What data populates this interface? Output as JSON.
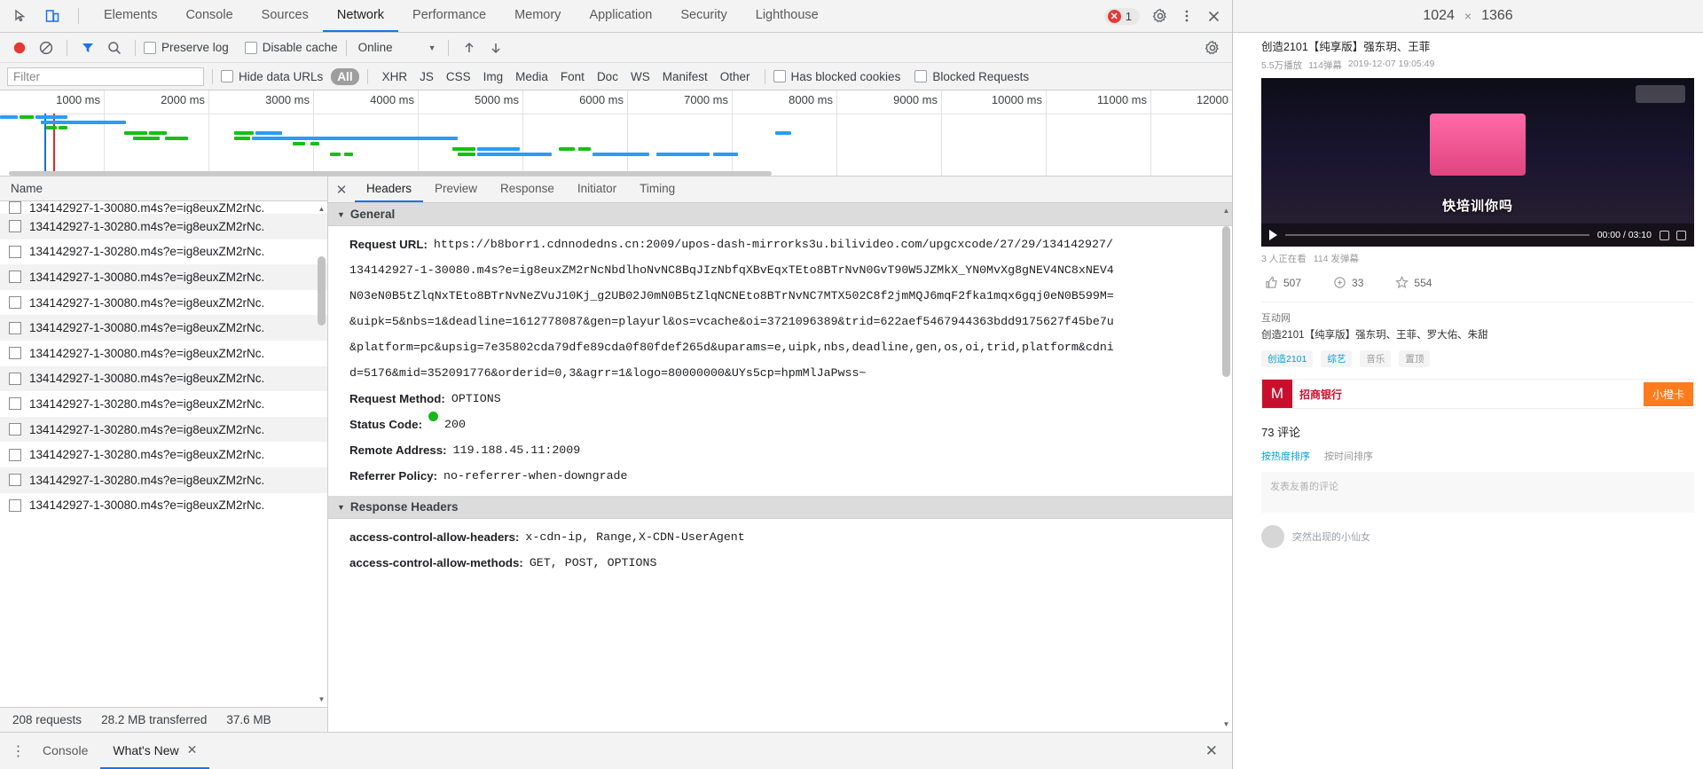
{
  "devtools": {
    "tabs": [
      {
        "label": "Elements",
        "active": false
      },
      {
        "label": "Console",
        "active": false
      },
      {
        "label": "Sources",
        "active": false
      },
      {
        "label": "Network",
        "active": true
      },
      {
        "label": "Performance",
        "active": false
      },
      {
        "label": "Memory",
        "active": false
      },
      {
        "label": "Application",
        "active": false
      },
      {
        "label": "Security",
        "active": false
      },
      {
        "label": "Lighthouse",
        "active": false
      }
    ],
    "error_count": "1",
    "icons": {
      "inspect": "inspect-element-icon",
      "device": "device-toolbar-icon",
      "settings": "gear-icon",
      "more": "kebab-menu-icon",
      "close": "close-icon"
    },
    "network_toolbar": {
      "record_label": "record-button",
      "clear_label": "clear-button",
      "filter_label": "filter-button",
      "search_label": "search-button",
      "preserve_log": "Preserve log",
      "disable_cache": "Disable cache",
      "throttle_value": "Online",
      "import_label": "import-har-button",
      "export_label": "export-har-button",
      "settings_label": "network-settings-button"
    },
    "filter_bar": {
      "placeholder": "Filter",
      "hide_data_urls": "Hide data URLs",
      "types": [
        "All",
        "XHR",
        "JS",
        "CSS",
        "Img",
        "Media",
        "Font",
        "Doc",
        "WS",
        "Manifest",
        "Other"
      ],
      "active_type": "All",
      "has_blocked_cookies": "Has blocked cookies",
      "blocked_requests": "Blocked Requests"
    },
    "overview": {
      "ticks": [
        "1000 ms",
        "2000 ms",
        "3000 ms",
        "4000 ms",
        "5000 ms",
        "6000 ms",
        "7000 ms",
        "8000 ms",
        "9000 ms",
        "10000 ms",
        "11000 ms",
        "12000"
      ]
    },
    "request_list": {
      "column_header": "Name",
      "rows": [
        {
          "name": "134142927-1-30080.m4s?e=ig8euxZM2rNc."
        },
        {
          "name": "134142927-1-30280.m4s?e=ig8euxZM2rNc."
        },
        {
          "name": "134142927-1-30280.m4s?e=ig8euxZM2rNc."
        },
        {
          "name": "134142927-1-30080.m4s?e=ig8euxZM2rNc."
        },
        {
          "name": "134142927-1-30080.m4s?e=ig8euxZM2rNc."
        },
        {
          "name": "134142927-1-30080.m4s?e=ig8euxZM2rNc."
        },
        {
          "name": "134142927-1-30080.m4s?e=ig8euxZM2rNc."
        },
        {
          "name": "134142927-1-30080.m4s?e=ig8euxZM2rNc."
        },
        {
          "name": "134142927-1-30280.m4s?e=ig8euxZM2rNc."
        },
        {
          "name": "134142927-1-30280.m4s?e=ig8euxZM2rNc."
        },
        {
          "name": "134142927-1-30280.m4s?e=ig8euxZM2rNc."
        },
        {
          "name": "134142927-1-30280.m4s?e=ig8euxZM2rNc."
        },
        {
          "name": "134142927-1-30080.m4s?e=ig8euxZM2rNc."
        }
      ]
    },
    "status_bar": {
      "requests": "208 requests",
      "transferred": "28.2 MB transferred",
      "resources": "37.6 MB"
    },
    "detail": {
      "tabs": [
        {
          "label": "Headers",
          "active": true
        },
        {
          "label": "Preview",
          "active": false
        },
        {
          "label": "Response",
          "active": false
        },
        {
          "label": "Initiator",
          "active": false
        },
        {
          "label": "Timing",
          "active": false
        }
      ],
      "general_title": "General",
      "request_url_key": "Request URL:",
      "request_url_lines": [
        "https://b8borr1.cdnnodedns.cn:2009/upos-dash-mirrorks3u.bilivideo.com/upgcxcode/27/29/134142927/",
        "134142927-1-30080.m4s?e=ig8euxZM2rNcNbdlhoNvNC8BqJIzNbfqXBvEqxTEto8BTrNvN0GvT90W5JZMkX_YN0MvXg8gNEV4NC8xNEV4",
        "N03eN0B5tZlqNxTEto8BTrNvNeZVuJ10Kj_g2UB02J0mN0B5tZlqNCNEto8BTrNvNC7MTX502C8f2jmMQJ6mqF2fka1mqx6gqj0eN0B599M=",
        "&uipk=5&nbs=1&deadline=1612778087&gen=playurl&os=vcache&oi=3721096389&trid=622aef5467944363bdd9175627f45be7u",
        "&platform=pc&upsig=7e35802cda79dfe89cda0f80fdef265d&uparams=e,uipk,nbs,deadline,gen,os,oi,trid,platform&cdni",
        "d=5176&mid=352091776&orderid=0,3&agrr=1&logo=80000000&UYs5cp=hpmMlJaPwss~"
      ],
      "fields": [
        {
          "key": "Request Method:",
          "value": "OPTIONS"
        },
        {
          "key": "Status Code:",
          "value": "200",
          "status": true
        },
        {
          "key": "Remote Address:",
          "value": "119.188.45.11:2009"
        },
        {
          "key": "Referrer Policy:",
          "value": "no-referrer-when-downgrade"
        }
      ],
      "response_headers_title": "Response Headers",
      "response_headers": [
        {
          "key": "access-control-allow-headers:",
          "value": "x-cdn-ip, Range,X-CDN-UserAgent"
        },
        {
          "key": "access-control-allow-methods:",
          "value": "GET, POST, OPTIONS"
        }
      ]
    },
    "drawer": {
      "menu_icon": "kebab-menu-icon",
      "tabs": [
        {
          "label": "Console",
          "active": false,
          "closable": false
        },
        {
          "label": "What's New",
          "active": true,
          "closable": true
        }
      ],
      "close_icon": "close-icon"
    }
  },
  "page": {
    "dimensions": {
      "width": "1024",
      "height": "1366",
      "separator": "×"
    },
    "video": {
      "title": "创造2101【纯享版】强东玥、王菲",
      "meta": [
        "5.5万播放",
        "114弹幕",
        "2019-12-07 19:05:49"
      ],
      "player_sub": "快培训你吗",
      "time": "00:00 / 03:10",
      "watch": [
        "3 人正在看",
        "114 发弹幕"
      ]
    },
    "actions": [
      {
        "icon": "thumb-up-icon",
        "count": "507"
      },
      {
        "icon": "coin-icon",
        "count": "33"
      },
      {
        "icon": "star-icon",
        "count": "554"
      }
    ],
    "related": {
      "heading": "互动网",
      "line": "创造2101【纯享版】强东玥、王菲、罗大佑、朱甜",
      "tags": [
        {
          "label": "创造2101",
          "muted": false
        },
        {
          "label": "综艺",
          "muted": false
        },
        {
          "label": "音乐",
          "muted": true
        },
        {
          "label": "置顶",
          "muted": true
        }
      ]
    },
    "ad": {
      "logo": "M",
      "text": "招商银行",
      "button": "小橙卡"
    },
    "comments": {
      "count": "73 评论",
      "sort": [
        {
          "label": "按热度排序",
          "active": true
        },
        {
          "label": "按时间排序",
          "active": false
        }
      ],
      "placeholder": "发表友善的评论",
      "first_comment": "突然出现的小仙女"
    }
  }
}
